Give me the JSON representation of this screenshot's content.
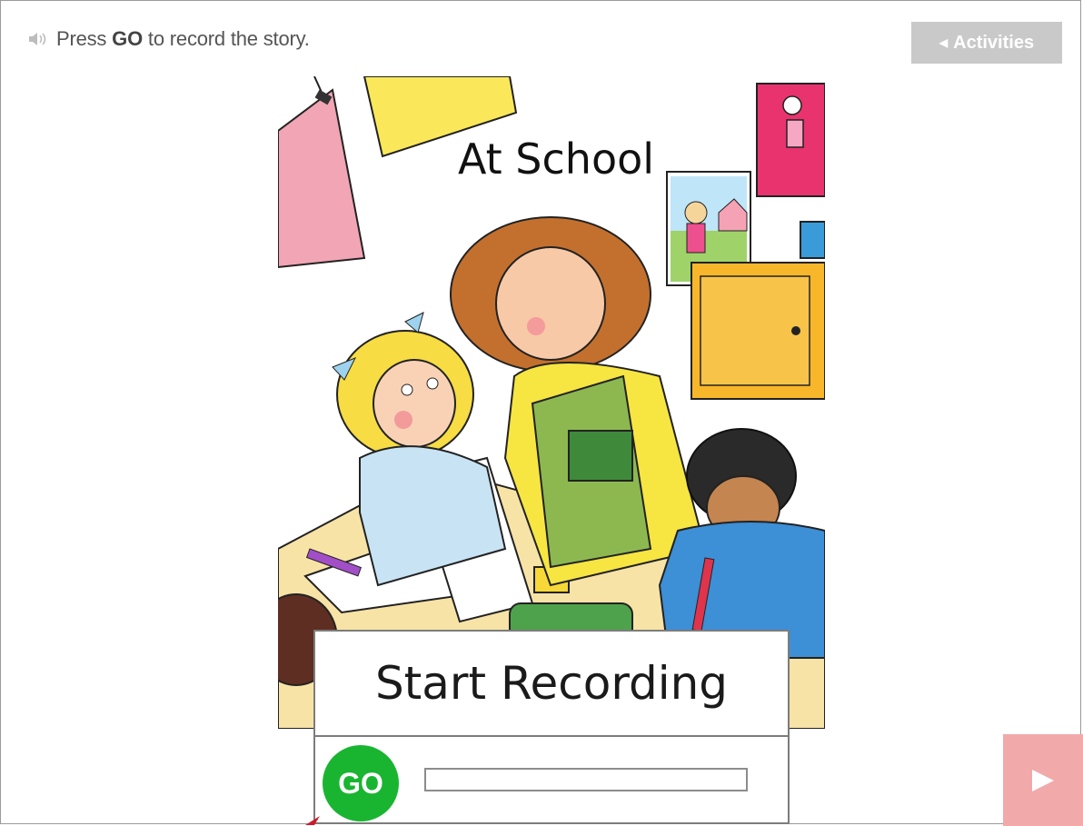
{
  "instruction": {
    "pre": "Press",
    "bold": "GO",
    "post": "to record the story."
  },
  "toolbar": {
    "activities_label": "Activities"
  },
  "book": {
    "title": "At School"
  },
  "recorder": {
    "title": "Start Recording",
    "go_label": "GO",
    "progress": 0
  },
  "icons": {
    "speaker": "speaker-icon",
    "back": "triangle-left-icon",
    "next": "play-next-icon",
    "cursor": "mouse-pointer-icon"
  },
  "colors": {
    "activities_bg": "#c9c9c9",
    "go_green": "#19b531",
    "next_bg": "#f2a9aa"
  }
}
